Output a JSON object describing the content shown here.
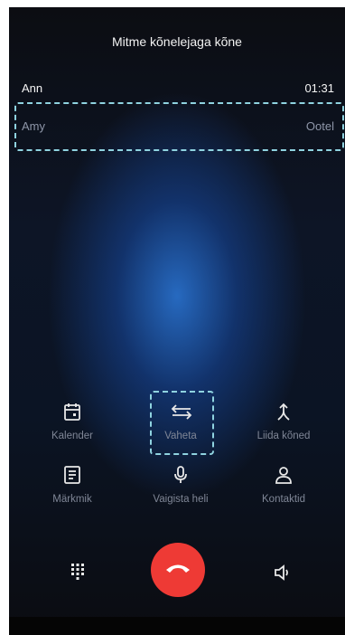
{
  "header": {
    "title": "Mitme kõnelejaga kõne"
  },
  "active_call": {
    "name": "Ann",
    "duration": "01:31"
  },
  "held_call": {
    "name": "Amy",
    "status": "Ootel"
  },
  "actions": [
    {
      "label": "Kalender",
      "icon": "calendar-icon"
    },
    {
      "label": "Vaheta",
      "icon": "swap-icon"
    },
    {
      "label": "Liida kõned",
      "icon": "merge-calls-icon"
    },
    {
      "label": "Märkmik",
      "icon": "notepad-icon"
    },
    {
      "label": "Vaigista heli",
      "icon": "microphone-icon"
    },
    {
      "label": "Kontaktid",
      "icon": "contacts-icon"
    }
  ],
  "bottom": {
    "keypad_icon": "keypad-icon",
    "end_call_icon": "end-call-icon",
    "speaker_icon": "speaker-icon"
  },
  "colors": {
    "end_call": "#ee3a35",
    "highlight_dash": "#8fd3e0",
    "label_grey": "#7f8696"
  }
}
